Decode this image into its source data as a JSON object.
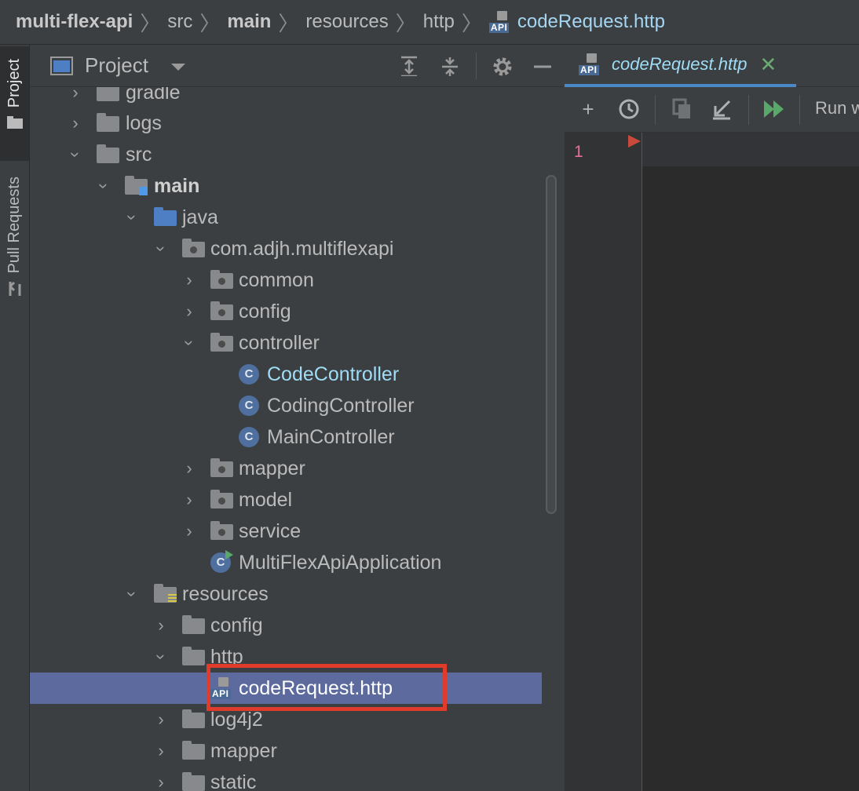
{
  "breadcrumb": {
    "items": [
      "multi-flex-api",
      "src",
      "main",
      "resources",
      "http"
    ],
    "file": "codeRequest.http",
    "icon_label": "API"
  },
  "sidebar": {
    "tabs": [
      "Project",
      "Pull Requests"
    ]
  },
  "panel": {
    "title": "Project"
  },
  "tree": {
    "rows": [
      {
        "label": "gradle"
      },
      {
        "label": "logs"
      },
      {
        "label": "src"
      },
      {
        "label": "main"
      },
      {
        "label": "java"
      },
      {
        "label": "com.adjh.multiflexapi"
      },
      {
        "label": "common"
      },
      {
        "label": "config"
      },
      {
        "label": "controller"
      },
      {
        "label": "CodeController"
      },
      {
        "label": "CodingController"
      },
      {
        "label": "MainController"
      },
      {
        "label": "mapper"
      },
      {
        "label": "model"
      },
      {
        "label": "service"
      },
      {
        "label": "MultiFlexApiApplication"
      },
      {
        "label": "resources"
      },
      {
        "label": "config"
      },
      {
        "label": "http"
      },
      {
        "label": "codeRequest.http"
      },
      {
        "label": "log4j2"
      },
      {
        "label": "mapper"
      },
      {
        "label": "static"
      }
    ],
    "class_icon_letter": "C",
    "api_icon_label": "API"
  },
  "editor": {
    "tab_label": "codeRequest.http",
    "tab_icon_label": "API",
    "toolbar_run_label": "Run w",
    "line_number": "1"
  },
  "colors": {
    "highlight_box": "#e03b2b",
    "selected_row": "#5c6a9e",
    "run_green": "#59a869"
  }
}
